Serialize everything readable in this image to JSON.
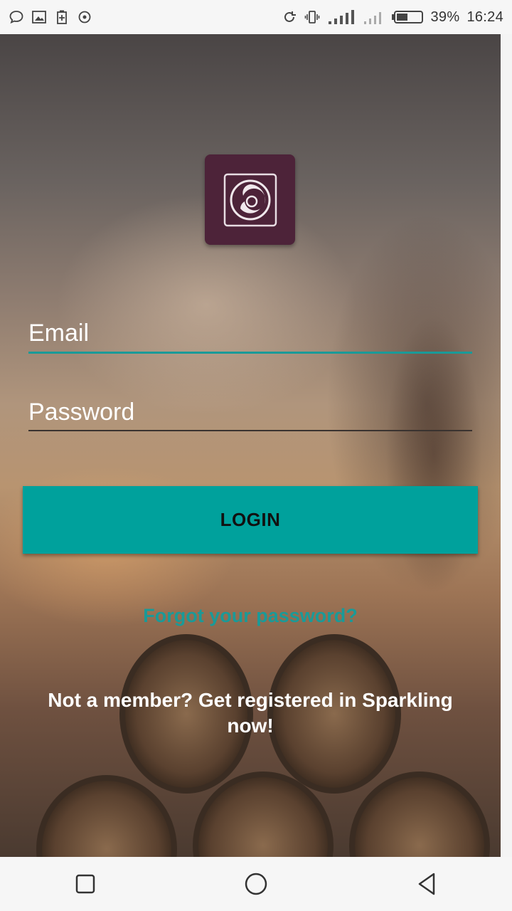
{
  "status_bar": {
    "left_icons": [
      "chat-bubble-icon",
      "image-icon",
      "battery-plus-icon",
      "sync-icon"
    ],
    "right_icons": [
      "rotate-icon",
      "vibrate-icon",
      "signal-icon",
      "signal-weak-icon",
      "battery-icon"
    ],
    "battery_text": "39%",
    "time": "16:24"
  },
  "logo": {
    "icon": "sparkling-logo-icon",
    "color": "#4d2339"
  },
  "form": {
    "email_placeholder": "Email",
    "password_placeholder": "Password",
    "login_label": "LOGIN",
    "forgot_label": "Forgot your password?",
    "register_text": "Not a member? Get registered in Sparkling now!"
  },
  "colors": {
    "accent": "#00a19c",
    "link": "#1a9a98"
  },
  "nav_bar": {
    "icons": [
      "recent-apps-icon",
      "home-icon",
      "back-icon"
    ]
  }
}
